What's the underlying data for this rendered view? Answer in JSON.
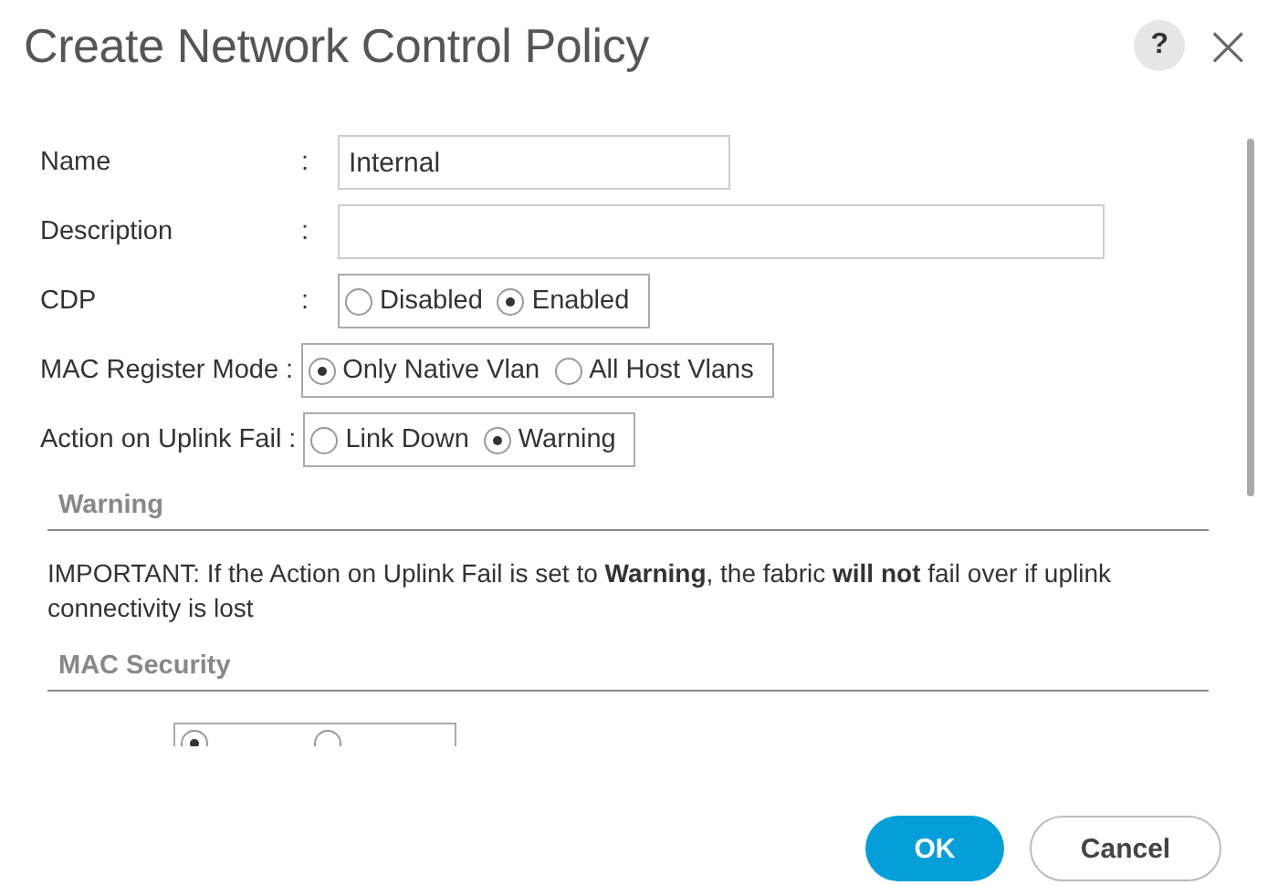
{
  "window": {
    "title": "Create Network Control Policy",
    "help": "?",
    "close": "×"
  },
  "fields": [
    {
      "kind": "text",
      "label": "Name",
      "colon": ":",
      "value": "Internal"
    },
    {
      "kind": "wide_text",
      "label": "Description",
      "colon": ":"
    },
    {
      "kind": "radio",
      "label": "CDP",
      "colon": ":",
      "options": [
        {
          "label": "Disabled",
          "selected": false
        },
        {
          "label": "Enabled",
          "selected": true
        }
      ]
    },
    {
      "kind": "radio",
      "label": "MAC Register Mode",
      "colon": ":",
      "options": [
        {
          "label": "Only Native Vlan",
          "selected": true
        },
        {
          "label": "All Host Vlans",
          "selected": false
        }
      ]
    },
    {
      "kind": "radio",
      "label": "Action on Uplink Fail",
      "colon": ":",
      "options": [
        {
          "label": "Link Down",
          "selected": false
        },
        {
          "label": "Warning",
          "selected": true
        }
      ]
    }
  ],
  "warning_section": {
    "title": "Warning",
    "text": "IMPORTANT: If the Action on Uplink Fail is set to **Warning**, the fabric **will not** fail over if uplink connectivity is lost"
  },
  "mac_security_section": {
    "title": "MAC Security",
    "partial_row": {
      "options": [
        {
          "selected": true
        },
        {
          "selected": false
        }
      ]
    }
  },
  "buttons": [
    {
      "label": "OK",
      "kind": "primary"
    },
    {
      "label": "Cancel",
      "kind": "secondary"
    }
  ]
}
